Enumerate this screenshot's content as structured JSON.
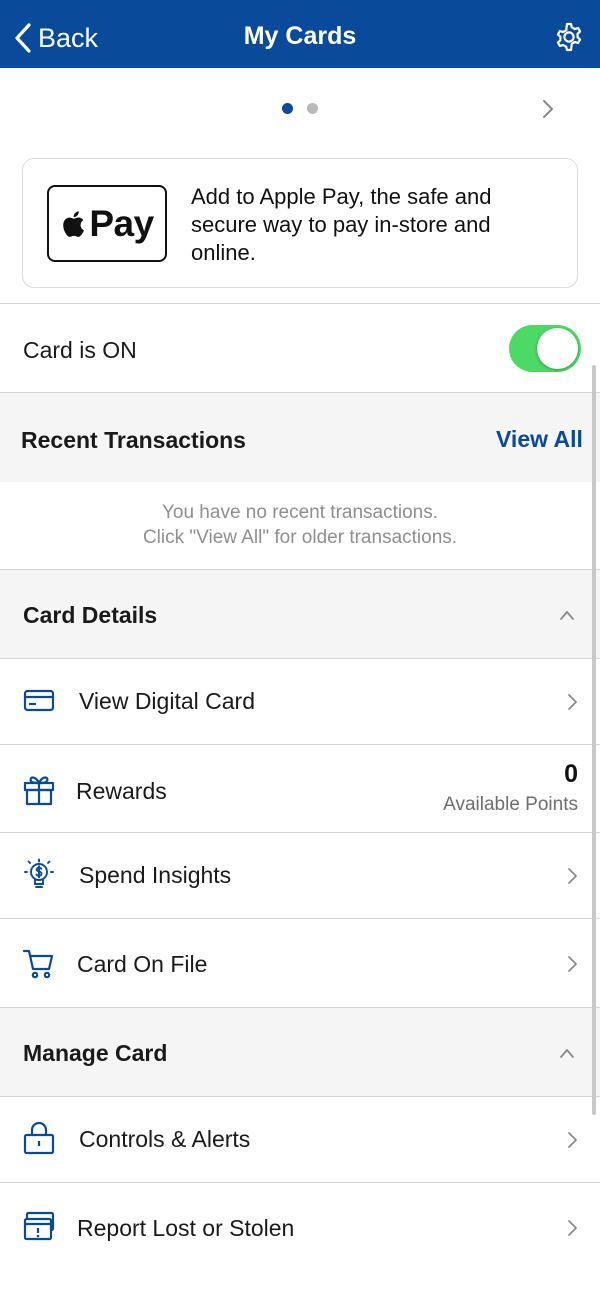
{
  "nav": {
    "back_label": "Back",
    "title": "My Cards"
  },
  "apple_pay": {
    "badge_text": "Pay",
    "message": "Add to Apple Pay, the safe and secure way to pay in-store and online."
  },
  "card_status": {
    "label": "Card is ON",
    "on": true
  },
  "transactions": {
    "title": "Recent Transactions",
    "view_all": "View All",
    "empty_line1": "You have no recent transactions.",
    "empty_line2": "Click \"View All\" for older transactions."
  },
  "card_details": {
    "title": "Card Details",
    "items": [
      {
        "label": "View Digital Card",
        "icon": "credit-card-icon"
      },
      {
        "label": "Rewards",
        "icon": "gift-icon",
        "points_value": "0",
        "points_label": "Available Points"
      },
      {
        "label": "Spend Insights",
        "icon": "lightbulb-dollar-icon"
      },
      {
        "label": "Card On File",
        "icon": "cart-icon"
      }
    ]
  },
  "manage_card": {
    "title": "Manage Card",
    "items": [
      {
        "label": "Controls & Alerts",
        "icon": "lock-icon"
      },
      {
        "label": "Report Lost or Stolen",
        "icon": "card-alert-icon"
      }
    ]
  },
  "colors": {
    "brand_blue": "#0a4a9a",
    "toggle_green": "#4cd964",
    "section_bg": "#f5f5f5"
  }
}
